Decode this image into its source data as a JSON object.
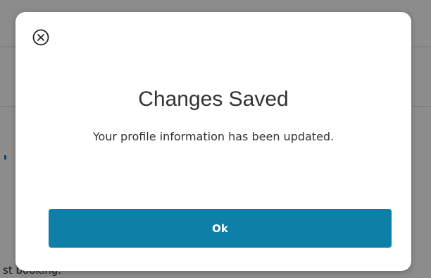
{
  "background": {
    "partial_text": "st booking."
  },
  "modal": {
    "close_icon": "close-circle-icon",
    "title": "Changes Saved",
    "message": "Your profile information has been updated.",
    "ok_label": "Ok"
  },
  "colors": {
    "primary_button": "#0e7fa6",
    "overlay": "rgba(0,0,0,0.45)",
    "text": "#333333"
  }
}
